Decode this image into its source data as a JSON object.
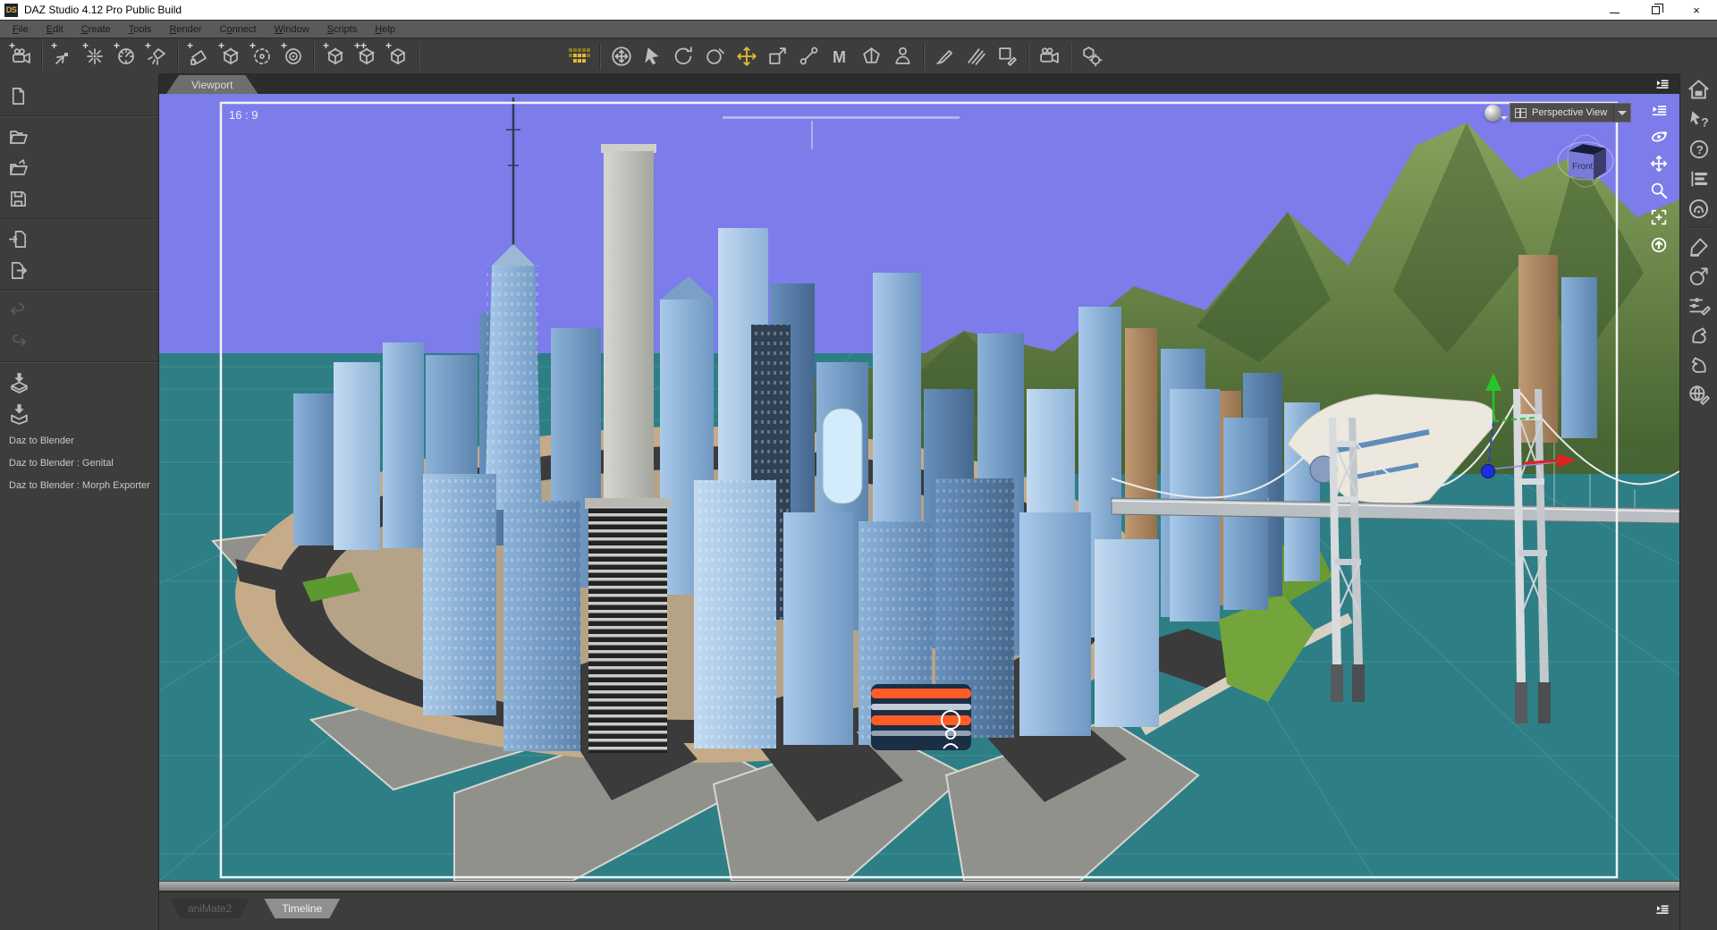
{
  "window": {
    "title": "DAZ Studio 4.12 Pro Public Build"
  },
  "menu": {
    "items": [
      {
        "pre": "",
        "u": "F",
        "post": "ile"
      },
      {
        "pre": "",
        "u": "E",
        "post": "dit"
      },
      {
        "pre": "",
        "u": "C",
        "post": "reate"
      },
      {
        "pre": "",
        "u": "T",
        "post": "ools"
      },
      {
        "pre": "",
        "u": "R",
        "post": "ender"
      },
      {
        "pre": "C",
        "u": "o",
        "post": "nnect"
      },
      {
        "pre": "",
        "u": "W",
        "post": "indow"
      },
      {
        "pre": "",
        "u": "S",
        "post": "cripts"
      },
      {
        "pre": "",
        "u": "H",
        "post": "elp"
      }
    ]
  },
  "toolbar": {
    "create_icons": [
      "new-camera-icon",
      "new-distant-light-icon",
      "new-point-light-icon",
      "new-sun-light-icon",
      "new-spotlight-icon",
      "new-primitive-icon",
      "new-node-icon",
      "new-group-icon",
      "new-null-icon",
      "new-node-instance-icon",
      "new-node-instances-icon",
      "new-cube-primitive-icon"
    ],
    "tool_icons": [
      "scene-grid-icon",
      "universal-tool-icon",
      "node-selection-tool-icon",
      "rotate-tool-icon",
      "twist-tool-icon",
      "translate-tool-icon",
      "scale-tool-icon",
      "joint-editor-icon",
      "measure-metrics-icon",
      "geometry-editor-icon",
      "figure-setup-icon",
      "brush-tool-icon",
      "hair-brush-tool-icon",
      "surface-selection-icon",
      "spot-render-icon",
      "node-gear-tool-icon"
    ],
    "active_tool": "translate-tool"
  },
  "left_sidebar": {
    "icons": [
      "new-file-icon",
      "open-file-icon",
      "merge-file-icon",
      "save-icon",
      "import-icon",
      "export-icon",
      "undo-icon",
      "redo-icon",
      "daz-to-blender-icon",
      "daz-to-blender-box-icon"
    ],
    "scripts": [
      "Daz to Blender",
      "Daz to Blender : Genital",
      "Daz to Blender : Morph Exporter"
    ]
  },
  "viewport": {
    "tab_label": "Viewport",
    "aspect_label": "16 : 9",
    "view_selector_label": "Perspective View",
    "view_cube_front_label": "Front",
    "camera_controls": [
      "pane-options-icon",
      "orbit-camera-icon",
      "pan-camera-icon",
      "zoom-camera-icon",
      "frame-camera-icon",
      "aim-camera-icon"
    ]
  },
  "right_sidebar": {
    "icons": [
      "daz-home-icon",
      "whats-this-icon",
      "help-icon",
      "panel-list-icon",
      "info-circle-icon",
      "configure-pen-icon",
      "sphere-arrow-icon",
      "sliders-pen-icon",
      "shaping-arm-icon",
      "posing-arm-icon",
      "environment-globe-icon"
    ]
  },
  "bottom_tabs": {
    "animate_label": "aniMate2",
    "timeline_label": "Timeline"
  },
  "colors": {
    "sky": "#7c7cea",
    "water": "#2e7e86",
    "mountain": "#5e7d3f",
    "active_tool_yellow": "#e2b838",
    "axis_x_red": "#e02222",
    "axis_y_green": "#27c427",
    "axis_z_blue": "#1c2fe0",
    "aspect_frame_white": "#f2f2f2",
    "accent_orange_building": "#ff5c28"
  }
}
